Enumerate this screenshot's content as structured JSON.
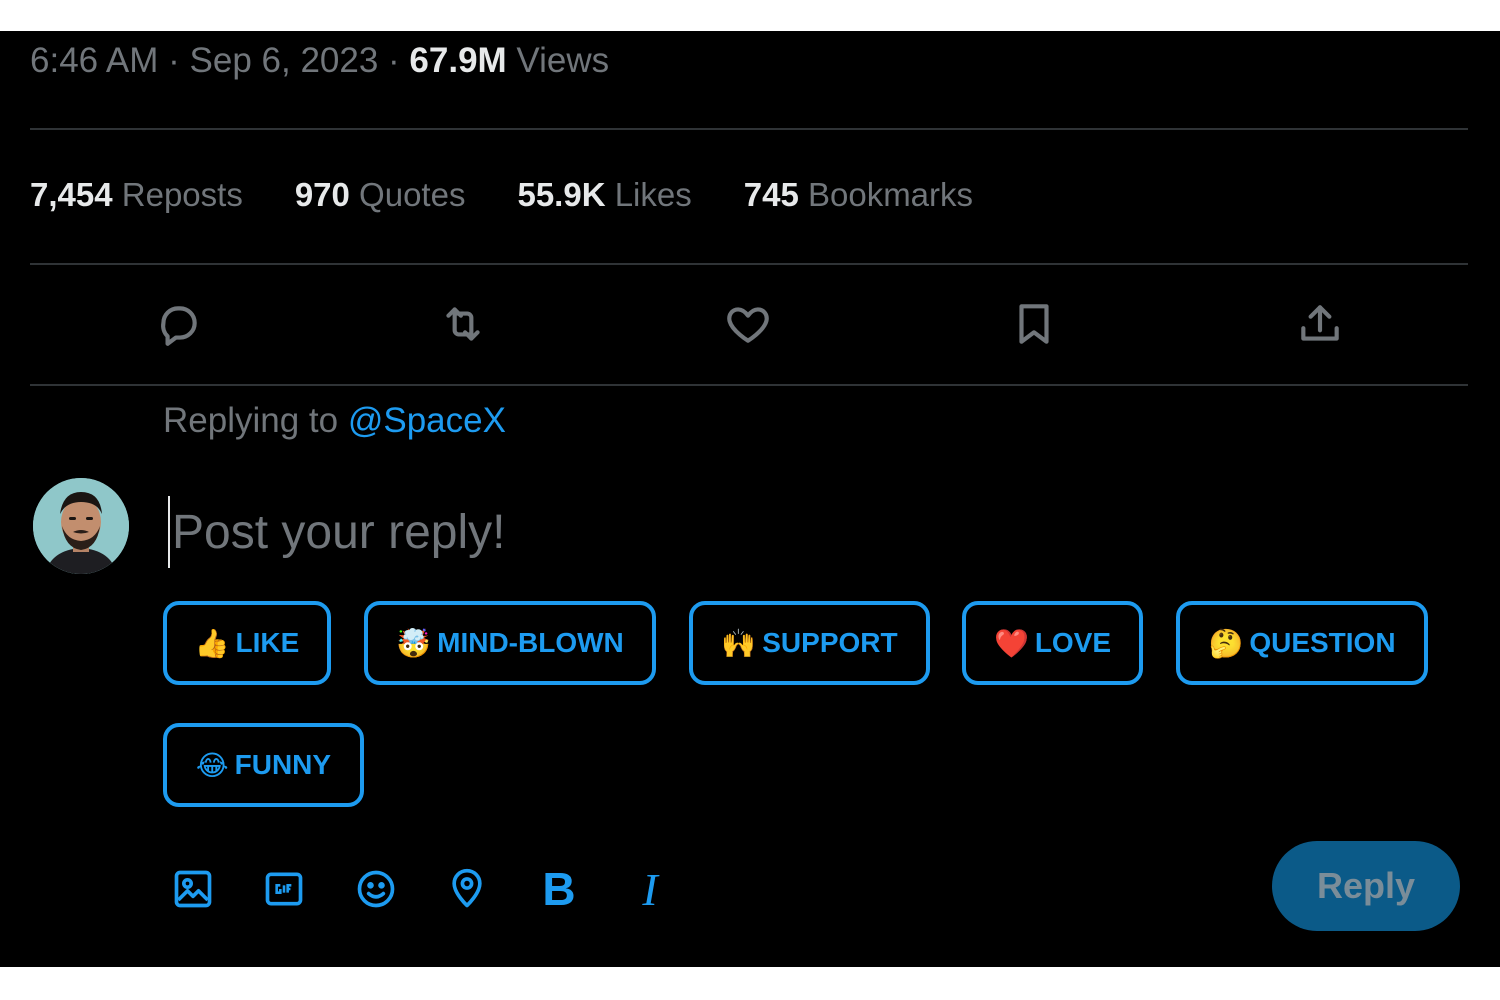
{
  "tweet_meta": {
    "time": "6:46 AM",
    "sep1": " · ",
    "date": "Sep 6, 2023",
    "sep2": " · ",
    "views_count": "67.9M",
    "views_label": " Views"
  },
  "stats": [
    {
      "count": "7,454",
      "label": " Reposts"
    },
    {
      "count": "970",
      "label": " Quotes"
    },
    {
      "count": "55.9K",
      "label": " Likes"
    },
    {
      "count": "745",
      "label": " Bookmarks"
    }
  ],
  "actions": [
    {
      "icon": "reply-icon"
    },
    {
      "icon": "repost-icon"
    },
    {
      "icon": "heart-icon"
    },
    {
      "icon": "bookmark-icon"
    },
    {
      "icon": "share-icon"
    }
  ],
  "replying": {
    "prefix": "Replying to ",
    "handle": "@SpaceX"
  },
  "composer": {
    "placeholder": "Post your reply!",
    "value": ""
  },
  "reactions": [
    {
      "emoji": "👍",
      "label": "LIKE"
    },
    {
      "emoji": "🤯",
      "label": "MIND-BLOWN"
    },
    {
      "emoji": "🙌",
      "label": "SUPPORT"
    },
    {
      "emoji": "❤️",
      "label": "LOVE"
    },
    {
      "emoji": "🤔",
      "label": "QUESTION"
    },
    {
      "emoji": "😂",
      "label": "FUNNY"
    }
  ],
  "toolbar": {
    "items": [
      "image-icon",
      "gif-icon",
      "emoji-icon",
      "location-icon",
      "bold-icon",
      "italic-icon"
    ],
    "bold_label": "B",
    "italic_label": "I"
  },
  "reply_button": {
    "label": "Reply"
  },
  "colors": {
    "background": "#000000",
    "accent": "#1d9bf0",
    "muted_text": "#71767b",
    "primary_text": "#e7e9ea",
    "divider": "#2f3336",
    "reply_button_bg": "#0b5a88"
  }
}
